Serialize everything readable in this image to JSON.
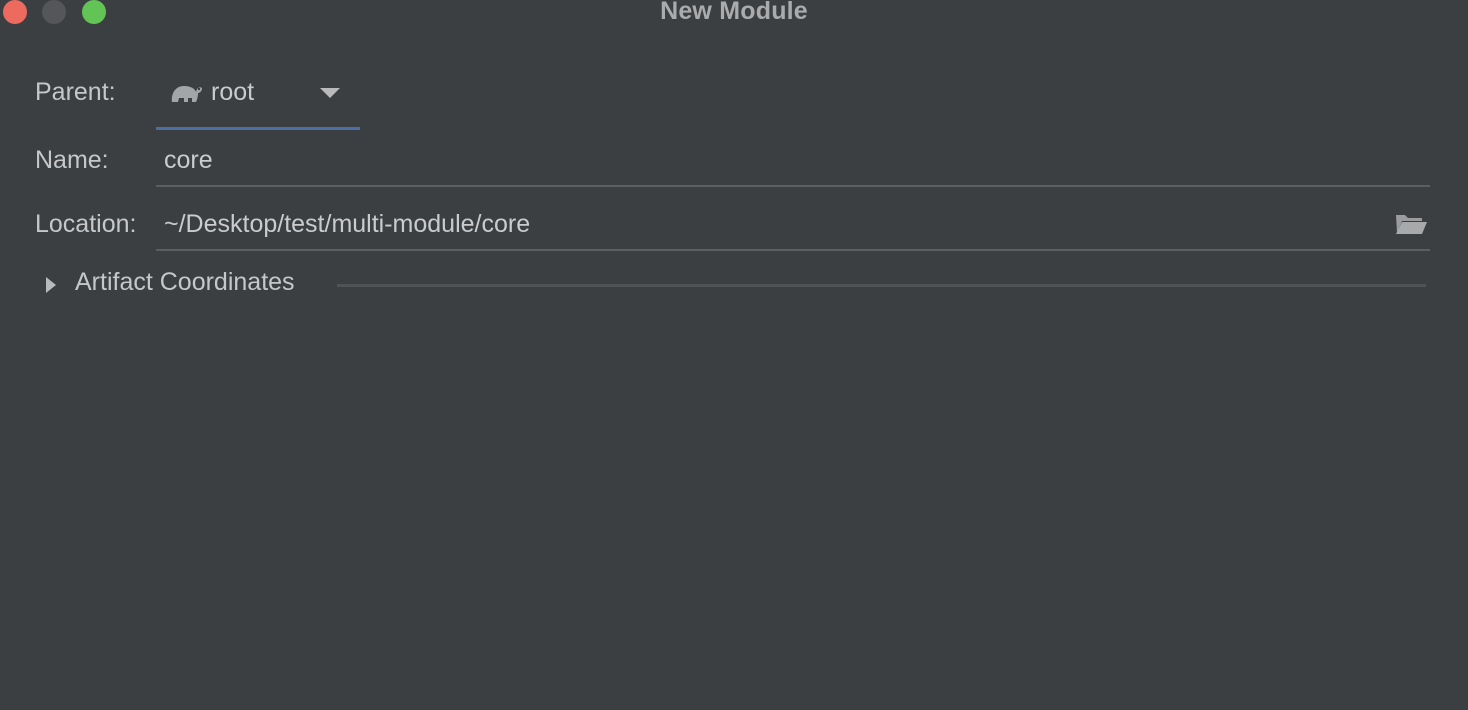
{
  "window": {
    "title": "New Module"
  },
  "form": {
    "parent": {
      "label": "Parent:",
      "value": "root",
      "icon": "gradle-elephant-icon"
    },
    "name": {
      "label": "Name:",
      "value": "core"
    },
    "location": {
      "label": "Location:",
      "value": "~/Desktop/test/multi-module/core",
      "icon": "folder-open-icon"
    }
  },
  "artifact": {
    "label": "Artifact Coordinates",
    "expanded": false
  },
  "colors": {
    "background": "#3c3f41",
    "accent_underline": "#4a6fa5",
    "close": "#ed6a5e",
    "minimize": "#545659",
    "maximize": "#61c454",
    "text": "#c5c7c9"
  }
}
